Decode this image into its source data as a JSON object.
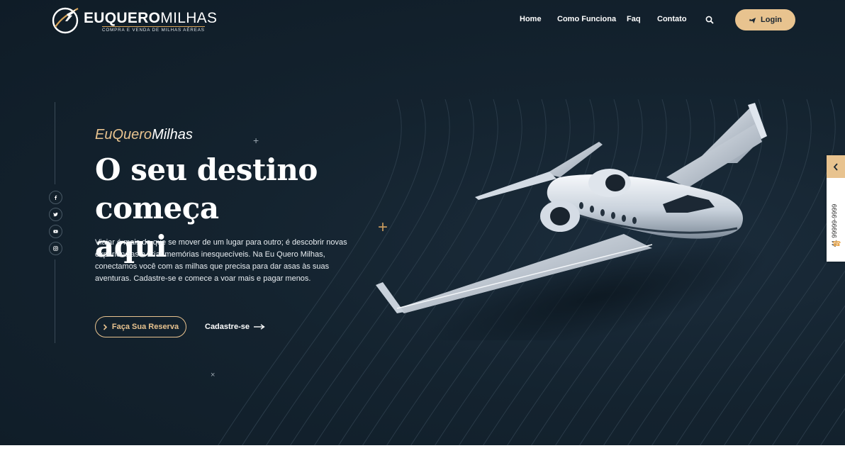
{
  "brand": {
    "name_bold": "EUQUERO",
    "name_light": "MILHAS",
    "tagline": "COMPRA E VENDA DE MILHAS AÉREAS"
  },
  "nav": {
    "items": [
      "Home",
      "Como Funciona",
      "Faq",
      "Contato"
    ],
    "search_icon": "search-icon",
    "login_label": "Login",
    "login_icon": "plane-icon"
  },
  "social": {
    "items": [
      "facebook-icon",
      "twitter-icon",
      "youtube-icon",
      "instagram-icon"
    ]
  },
  "hero": {
    "eyebrow_gold": "EuQuero",
    "eyebrow_white": "Milhas",
    "headline_line1": "O seu destino começa",
    "headline_line2": "aqui",
    "description": "Viajar é mais do que se mover de um lugar para outro; é descobrir novas experiências e criar memórias inesquecíveis. Na Eu Quero Milhas, conectamos você com as milhas que precisa para dar asas às suas aventuras. Cadastre-se e comece a voar mais e pagar menos.",
    "reserve_label": "Faça Sua Reserva",
    "signup_label": "Cadastre-se"
  },
  "side_tab": {
    "phone": "41 99999-9999"
  },
  "colors": {
    "background": "#14232f",
    "accent": "#e8c38f",
    "text": "#ffffff"
  }
}
